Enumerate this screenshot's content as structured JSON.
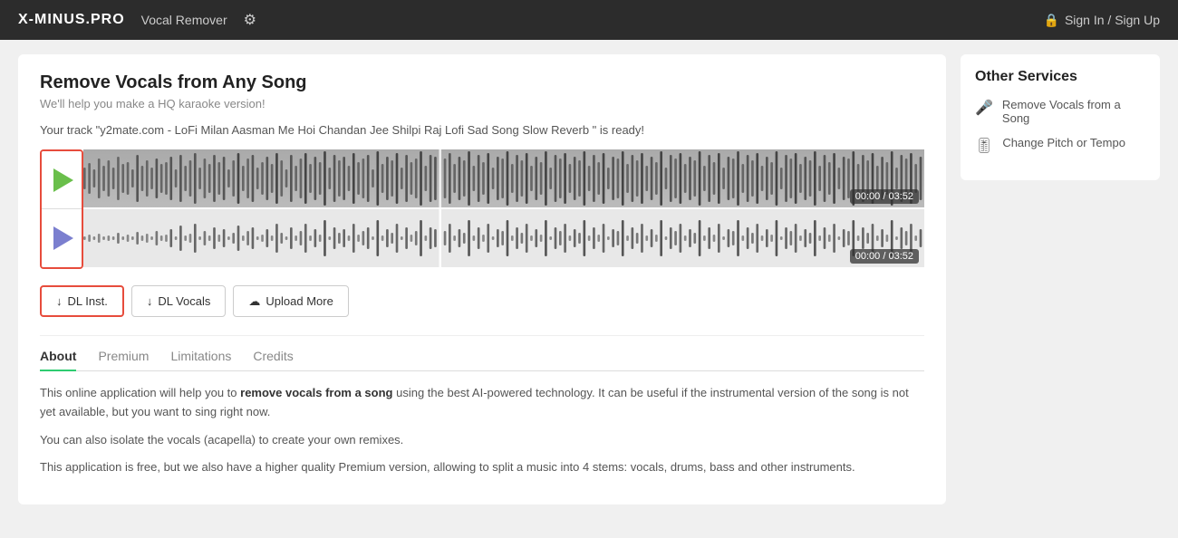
{
  "header": {
    "logo": "X-MINUS.PRO",
    "nav_item": "Vocal Remover",
    "sign_in": "Sign In / Sign Up"
  },
  "main": {
    "title": "Remove Vocals from Any Song",
    "subtitle": "We'll help you make a HQ karaoke version!",
    "track_ready": "Your track \"y2mate.com - LoFi Milan Aasman Me Hoi Chandan Jee Shilpi Raj Lofi Sad Song Slow Reverb \" is ready!",
    "player": {
      "time_top": "00:00 / 03:52",
      "time_bottom": "00:00 / 03:52"
    },
    "buttons": {
      "dl_inst": "DL Inst.",
      "dl_vocals": "DL Vocals",
      "upload_more": "Upload More"
    },
    "tabs": [
      {
        "id": "about",
        "label": "About",
        "active": true
      },
      {
        "id": "premium",
        "label": "Premium",
        "active": false
      },
      {
        "id": "limitations",
        "label": "Limitations",
        "active": false
      },
      {
        "id": "credits",
        "label": "Credits",
        "active": false
      }
    ],
    "tab_content": {
      "para1": "This online application will help you to remove vocals from a song using the best AI-powered technology. It can be useful if the instrumental version of the song is not yet available, but you want to sing right now.",
      "para1_bold": "remove vocals from a song",
      "para2": "You can also isolate the vocals (acapella) to create your own remixes.",
      "para3": "This application is free, but we also have a higher quality Premium version, allowing to split a music into 4 stems: vocals, drums, bass and other instruments."
    }
  },
  "sidebar": {
    "title": "Other Services",
    "items": [
      {
        "label": "Remove Vocals from a Song",
        "icon": "🎤"
      },
      {
        "label": "Change Pitch or Tempo",
        "icon": "🎚"
      }
    ]
  }
}
